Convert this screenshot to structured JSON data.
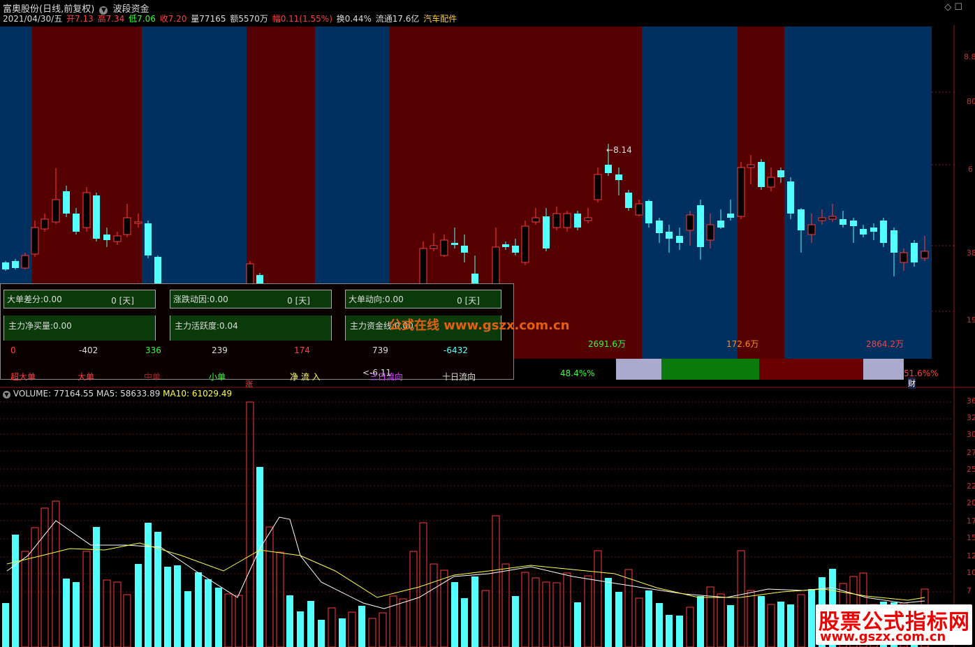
{
  "header": {
    "title": "富奥股份(日线,前复权)",
    "indicator": "波段资金",
    "date": "2021/04/30/五",
    "open_label": "开7.13",
    "high_label": "高7.34",
    "low_label": "低7.06",
    "close_label": "收7.20",
    "vol_label": "量77165",
    "amount_label": "额5570万",
    "change_label": "幅0.11(1.55%)",
    "turnover_label": "换0.44%",
    "float_label": "流通17.6亿",
    "sector_label": "汽车配件"
  },
  "axis_right": {
    "price_ticks": [
      "8.8",
      "80",
      "6",
      "38",
      "19"
    ],
    "vol_ticks": [
      "36",
      "32",
      "30",
      "27",
      "25",
      "22",
      "20",
      "17",
      "15",
      "12",
      "10",
      "7"
    ]
  },
  "price_annot": {
    "high_mark": "8.14"
  },
  "zone_labels": {
    "a": "2691.6万",
    "b": "172.6万",
    "c": "2864.2万"
  },
  "bar_labels": {
    "pct1": "48.4%%",
    "pct2": "51.6%%",
    "cai": "财",
    "zhang": "涨"
  },
  "panel": {
    "row1": [
      {
        "label": "大单差分:0.00",
        "days": "0 [天]"
      },
      {
        "label": "涨跌动因:0.00",
        "days": "0 [天]"
      },
      {
        "label": "大单动向:0.00",
        "days": "0 [天]"
      }
    ],
    "row2": [
      {
        "label": "主力净买量:0.00"
      },
      {
        "label": "主力活跃度:0.04"
      },
      {
        "label": "主力资金线:0.00"
      }
    ],
    "watermark": "公式在线 www.gszx.com.cn",
    "numbers": [
      "0",
      "-402",
      "336",
      "239",
      "174",
      "739",
      "-6432"
    ],
    "legend": [
      "超大单",
      "大单",
      "中单",
      "小单",
      "净 流 入",
      "三日流向",
      "十日流向"
    ],
    "overlay": "<-6.11"
  },
  "volume": {
    "label": "VOLUME: 77164.55",
    "ma5": "MA5: 58633.89",
    "ma10": "MA10: 61029.49"
  },
  "brand": {
    "line1": "股票公式指标网",
    "line2": "www.gszx.com.cn"
  },
  "colors": {
    "up": "#ff3c3c",
    "down": "#54ffff",
    "zone_red": "#550000",
    "zone_blue": "#003060"
  }
}
